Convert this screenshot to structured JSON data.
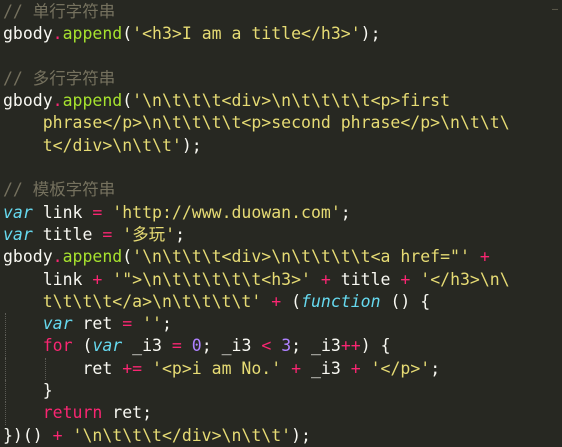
{
  "editor": {
    "gutter_mark": "—"
  },
  "lines": [
    [
      {
        "t": "// 单行字符串",
        "c": "c-comment"
      }
    ],
    [
      {
        "t": "gbody",
        "c": "c-plain"
      },
      {
        "t": ".",
        "c": "c-kw"
      },
      {
        "t": "append",
        "c": "c-fn"
      },
      {
        "t": "(",
        "c": "c-plain"
      },
      {
        "t": "'<h3>I am a title</h3>'",
        "c": "c-str"
      },
      {
        "t": ");",
        "c": "c-plain"
      }
    ],
    [],
    [
      {
        "t": "// 多行字符串",
        "c": "c-comment"
      }
    ],
    [
      {
        "t": "gbody",
        "c": "c-plain"
      },
      {
        "t": ".",
        "c": "c-kw"
      },
      {
        "t": "append",
        "c": "c-fn"
      },
      {
        "t": "(",
        "c": "c-plain"
      },
      {
        "t": "'\\n\\t\\t\\t<div>\\n\\t\\t\\t\\t<p>first",
        "c": "c-str"
      }
    ],
    [
      {
        "t": "    phrase</p>\\n\\t\\t\\t\\t<p>second phrase</p>\\n\\t\\t\\",
        "c": "c-str"
      }
    ],
    [
      {
        "t": "    t</div>\\n\\t\\t'",
        "c": "c-str"
      },
      {
        "t": ");",
        "c": "c-plain"
      }
    ],
    [],
    [
      {
        "t": "// 模板字符串",
        "c": "c-comment"
      }
    ],
    [
      {
        "t": "var",
        "c": "c-ital"
      },
      {
        "t": " link ",
        "c": "c-plain"
      },
      {
        "t": "=",
        "c": "c-kw"
      },
      {
        "t": " ",
        "c": "c-plain"
      },
      {
        "t": "'http://www.duowan.com'",
        "c": "c-str"
      },
      {
        "t": ";",
        "c": "c-plain"
      }
    ],
    [
      {
        "t": "var",
        "c": "c-ital"
      },
      {
        "t": " title ",
        "c": "c-plain"
      },
      {
        "t": "=",
        "c": "c-kw"
      },
      {
        "t": " ",
        "c": "c-plain"
      },
      {
        "t": "'多玩'",
        "c": "c-str"
      },
      {
        "t": ";",
        "c": "c-plain"
      }
    ],
    [
      {
        "t": "gbody",
        "c": "c-plain"
      },
      {
        "t": ".",
        "c": "c-kw"
      },
      {
        "t": "append",
        "c": "c-fn"
      },
      {
        "t": "(",
        "c": "c-plain"
      },
      {
        "t": "'\\n\\t\\t\\t<div>\\n\\t\\t\\t\\t<a href=\"'",
        "c": "c-str"
      },
      {
        "t": " ",
        "c": "c-plain"
      },
      {
        "t": "+",
        "c": "c-kw"
      }
    ],
    [
      {
        "t": "    link ",
        "c": "c-plain"
      },
      {
        "t": "+",
        "c": "c-kw"
      },
      {
        "t": " ",
        "c": "c-plain"
      },
      {
        "t": "'\">\\n\\t\\t\\t\\t\\t<h3>'",
        "c": "c-str"
      },
      {
        "t": " ",
        "c": "c-plain"
      },
      {
        "t": "+",
        "c": "c-kw"
      },
      {
        "t": " title ",
        "c": "c-plain"
      },
      {
        "t": "+",
        "c": "c-kw"
      },
      {
        "t": " ",
        "c": "c-plain"
      },
      {
        "t": "'</h3>\\n\\",
        "c": "c-str"
      }
    ],
    [
      {
        "t": "    t\\t\\t\\t</a>\\n\\t\\t\\t\\t'",
        "c": "c-str"
      },
      {
        "t": " ",
        "c": "c-plain"
      },
      {
        "t": "+",
        "c": "c-kw"
      },
      {
        "t": " (",
        "c": "c-plain"
      },
      {
        "t": "function",
        "c": "c-ital"
      },
      {
        "t": " () {",
        "c": "c-plain"
      }
    ],
    [
      {
        "t": "    ",
        "c": "c-plain"
      },
      {
        "t": "var",
        "c": "c-ital"
      },
      {
        "t": " ret ",
        "c": "c-plain"
      },
      {
        "t": "=",
        "c": "c-kw"
      },
      {
        "t": " ",
        "c": "c-plain"
      },
      {
        "t": "''",
        "c": "c-str"
      },
      {
        "t": ";",
        "c": "c-plain"
      }
    ],
    [
      {
        "t": "    ",
        "c": "c-plain"
      },
      {
        "t": "for",
        "c": "c-kw"
      },
      {
        "t": " (",
        "c": "c-plain"
      },
      {
        "t": "var",
        "c": "c-ital"
      },
      {
        "t": " _i3 ",
        "c": "c-plain"
      },
      {
        "t": "=",
        "c": "c-kw"
      },
      {
        "t": " ",
        "c": "c-plain"
      },
      {
        "t": "0",
        "c": "c-num"
      },
      {
        "t": "; _i3 ",
        "c": "c-plain"
      },
      {
        "t": "<",
        "c": "c-kw"
      },
      {
        "t": " ",
        "c": "c-plain"
      },
      {
        "t": "3",
        "c": "c-num"
      },
      {
        "t": "; _i3",
        "c": "c-plain"
      },
      {
        "t": "++",
        "c": "c-kw"
      },
      {
        "t": ") {",
        "c": "c-plain"
      }
    ],
    [
      {
        "t": "        ret ",
        "c": "c-plain"
      },
      {
        "t": "+=",
        "c": "c-kw"
      },
      {
        "t": " ",
        "c": "c-plain"
      },
      {
        "t": "'<p>i am No.'",
        "c": "c-str"
      },
      {
        "t": " ",
        "c": "c-plain"
      },
      {
        "t": "+",
        "c": "c-kw"
      },
      {
        "t": " _i3 ",
        "c": "c-plain"
      },
      {
        "t": "+",
        "c": "c-kw"
      },
      {
        "t": " ",
        "c": "c-plain"
      },
      {
        "t": "'</p>'",
        "c": "c-str"
      },
      {
        "t": ";",
        "c": "c-plain"
      }
    ],
    [
      {
        "t": "    }",
        "c": "c-plain"
      }
    ],
    [
      {
        "t": "    ",
        "c": "c-plain"
      },
      {
        "t": "return",
        "c": "c-kw"
      },
      {
        "t": " ret;",
        "c": "c-plain"
      }
    ],
    [
      {
        "t": "})() ",
        "c": "c-plain"
      },
      {
        "t": "+",
        "c": "c-kw"
      },
      {
        "t": " ",
        "c": "c-plain"
      },
      {
        "t": "'\\n\\t\\t\\t</div>\\n\\t\\t'",
        "c": "c-str"
      },
      {
        "t": ");",
        "c": "c-plain"
      }
    ]
  ]
}
